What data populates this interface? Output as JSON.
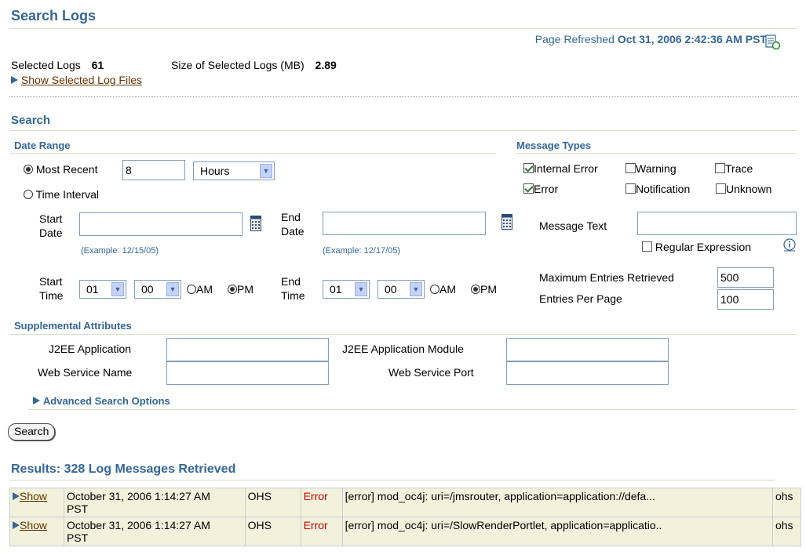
{
  "header": {
    "title": "Search Logs",
    "refresh_label": "Page Refreshed",
    "refresh_time": "Oct 31, 2006 2:42:36 AM PST"
  },
  "summary": {
    "selected_logs_label": "Selected Logs",
    "selected_logs_value": "61",
    "size_label": "Size of Selected Logs (MB)",
    "size_value": "2.89",
    "show_selected_label": "Show Selected Log Files"
  },
  "search": {
    "title": "Search",
    "date_range": {
      "title": "Date Range",
      "most_recent_label": "Most Recent",
      "most_recent_value": "8",
      "unit_value": "Hours",
      "time_interval_label": "Time Interval",
      "start_date_label_1": "Start",
      "start_date_label_2": "Date",
      "end_date_label_1": "End",
      "end_date_label_2": "Date",
      "start_example": "(Example: 12/15/05)",
      "end_example": "(Example: 12/17/05)",
      "start_time_label_1": "Start",
      "start_time_label_2": "Time",
      "end_time_label_1": "End",
      "end_time_label_2": "Time",
      "start_hour": "01",
      "start_min": "00",
      "end_hour": "01",
      "end_min": "00",
      "am_label": "AM",
      "pm_label": "PM"
    },
    "message_types": {
      "title": "Message Types",
      "internal_error": "Internal Error",
      "warning": "Warning",
      "trace": "Trace",
      "error": "Error",
      "notification": "Notification",
      "unknown": "Unknown",
      "message_text_label": "Message Text",
      "regex_label": "Regular Expression",
      "max_entries_label": "Maximum Entries Retrieved",
      "max_entries_value": "500",
      "per_page_label": "Entries Per Page",
      "per_page_value": "100"
    },
    "supplemental": {
      "title": "Supplemental Attributes",
      "j2ee_app_label": "J2EE Application",
      "j2ee_module_label": "J2EE Application Module",
      "ws_name_label": "Web Service Name",
      "ws_port_label": "Web Service Port"
    },
    "advanced_label": "Advanced Search Options",
    "search_button": "Search"
  },
  "results": {
    "title": "Results: 328 Log Messages Retrieved",
    "rows": [
      {
        "show": "Show",
        "time_1": "October 31, 2006 1:14:27 AM",
        "time_2": "PST",
        "component": "OHS",
        "type": "Error",
        "message": "[error] mod_oc4j: uri=/jmsrouter, application=application://defa...",
        "host": "ohs"
      },
      {
        "show": "Show",
        "time_1": "October 31, 2006 1:14:27 AM",
        "time_2": "PST",
        "component": "OHS",
        "type": "Error",
        "message": "[error] mod_oc4j: uri=/SlowRenderPortlet, application=applicatio..",
        "host": "ohs"
      }
    ]
  },
  "colors": {
    "heading": "#336699",
    "link": "#663300",
    "error": "#cc0000",
    "row_bg": "#f2f2dc"
  }
}
